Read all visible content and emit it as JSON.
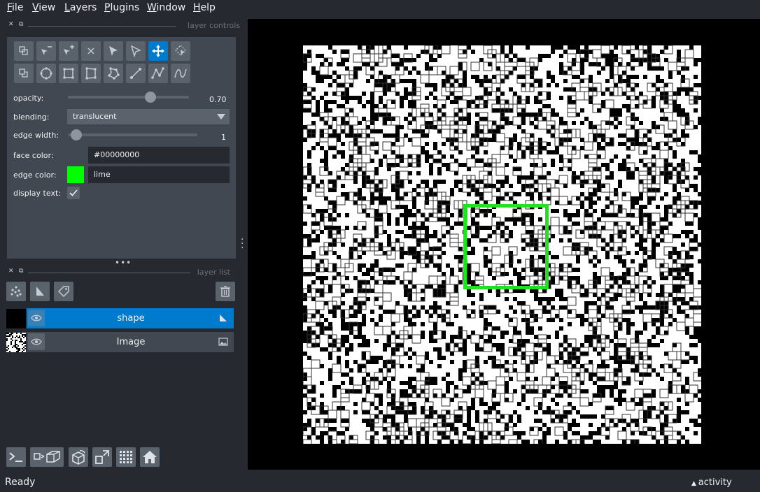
{
  "menu": [
    "File",
    "View",
    "Layers",
    "Plugins",
    "Window",
    "Help"
  ],
  "menu_mnemonics": [
    "F",
    "V",
    "L",
    "P",
    "W",
    "H"
  ],
  "layer_controls": {
    "title": "layer controls",
    "tools_row1": [
      "shuffle-layer-icon",
      "remove-vertex-icon",
      "add-vertex-icon",
      "delete-shape-icon",
      "direct-select-icon",
      "select-icon",
      "pan-zoom-icon",
      "lasso-select-icon"
    ],
    "tools_row2": [
      "move-back-icon",
      "ellipse-icon",
      "rectangle-icon",
      "polygon-icon",
      "polygon-lasso-icon",
      "line-icon",
      "path-icon",
      "polyline-icon"
    ],
    "active_tool": "pan-zoom-icon",
    "opacity_label": "opacity:",
    "opacity_value": "0.70",
    "opacity_fraction": 0.7,
    "blending_label": "blending:",
    "blending_value": "translucent",
    "edge_width_label": "edge width:",
    "edge_width_value": "1",
    "face_color_label": "face color:",
    "face_color_value": "#00000000",
    "edge_color_label": "edge color:",
    "edge_color_value": "lime",
    "edge_color_swatch": "#00ff00",
    "display_text_label": "display text:",
    "display_text_checked": true
  },
  "layer_list": {
    "title": "layer list",
    "buttons": [
      "new-points-icon",
      "new-shapes-icon",
      "new-labels-icon",
      "delete-layer-icon"
    ],
    "layers": [
      {
        "name": "shape",
        "selected": true,
        "visible": true,
        "type_icon": "shapes-icon"
      },
      {
        "name": "Image",
        "selected": false,
        "visible": true,
        "type_icon": "image-icon"
      }
    ]
  },
  "bottom_buttons": [
    "console-icon",
    "ndisplay-toggle-icon",
    "roll-dims-icon",
    "transpose-icon",
    "grid-icon",
    "home-icon"
  ],
  "status": {
    "text": "Ready",
    "activity": "activity"
  },
  "colors": {
    "background": "#262930",
    "panel": "#414851",
    "button": "#5a626c",
    "accent": "#007acc",
    "shape_edge": "#22e022"
  }
}
